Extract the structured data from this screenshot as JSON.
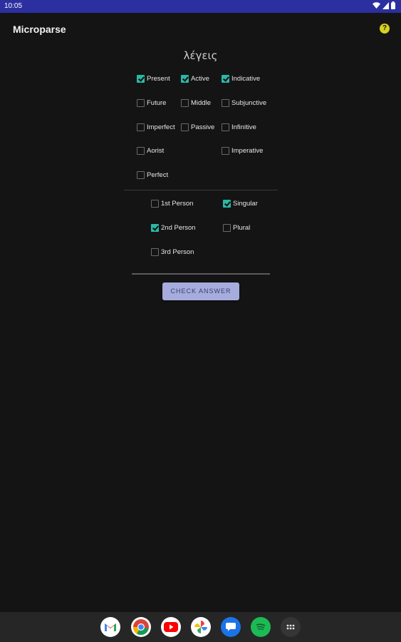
{
  "status_bar": {
    "time": "10:05"
  },
  "app": {
    "title": "Microparse"
  },
  "word": "λέγεις",
  "tense": [
    {
      "label": "Present",
      "checked": true
    },
    {
      "label": "Future",
      "checked": false
    },
    {
      "label": "Imperfect",
      "checked": false
    },
    {
      "label": "Aorist",
      "checked": false
    },
    {
      "label": "Perfect",
      "checked": false
    }
  ],
  "voice": [
    {
      "label": "Active",
      "checked": true
    },
    {
      "label": "Middle",
      "checked": false
    },
    {
      "label": "Passive",
      "checked": false
    }
  ],
  "mood": [
    {
      "label": "Indicative",
      "checked": true
    },
    {
      "label": "Subjunctive",
      "checked": false
    },
    {
      "label": "Infinitive",
      "checked": false
    },
    {
      "label": "Imperative",
      "checked": false
    }
  ],
  "person": [
    {
      "label": "1st Person",
      "checked": false
    },
    {
      "label": "2nd Person",
      "checked": true
    },
    {
      "label": "3rd Person",
      "checked": false
    }
  ],
  "number": [
    {
      "label": "Singular",
      "checked": true
    },
    {
      "label": "Plural",
      "checked": false
    }
  ],
  "check_button": {
    "label": "CHECK ANSWER"
  },
  "dock": [
    {
      "icon": "gmail-icon"
    },
    {
      "icon": "chrome-icon"
    },
    {
      "icon": "youtube-icon"
    },
    {
      "icon": "photos-icon"
    },
    {
      "icon": "messages-icon"
    },
    {
      "icon": "spotify-icon"
    },
    {
      "icon": "app-drawer-icon"
    }
  ]
}
